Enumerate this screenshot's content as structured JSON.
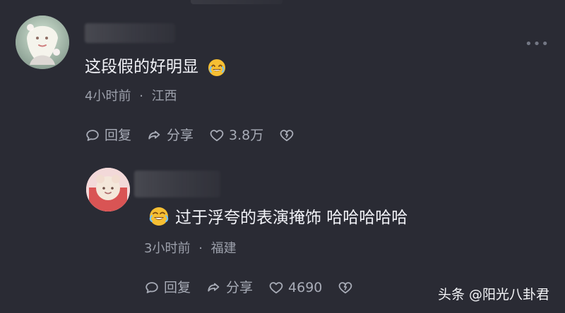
{
  "comments": [
    {
      "text": "这段假的好明显",
      "time": "4小时前",
      "separator": "·",
      "location": "江西",
      "reply_label": "回复",
      "share_label": "分享",
      "like_count": "3.8万",
      "emoji_icon": "laughing-face-icon"
    },
    {
      "text": "过于浮夸的表演掩饰 哈哈哈哈哈",
      "time": "3小时前",
      "separator": "·",
      "location": "福建",
      "reply_label": "回复",
      "share_label": "分享",
      "like_count": "4690",
      "emoji_icon": "rolling-laughing-face-icon"
    }
  ],
  "ui": {
    "watermark": "头条 @阳光八卦君",
    "more_icon": "more-icon"
  },
  "colors": {
    "background": "#2a2b34",
    "text_primary": "#f1f2f7",
    "text_secondary": "#9ca0ab",
    "accent_yellow": "#f6bf33"
  }
}
